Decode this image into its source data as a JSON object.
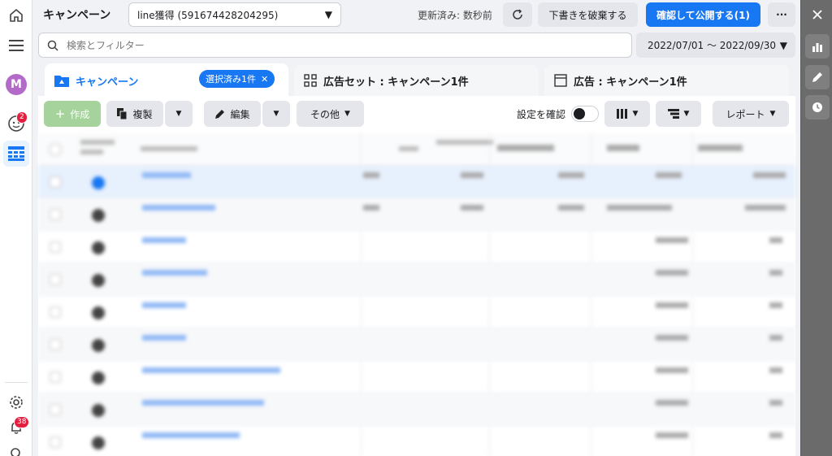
{
  "app_title": "キャンペーン",
  "account": {
    "selected": "line獲得 (591674428204295)"
  },
  "status": {
    "updated": "更新済み: 数秒前"
  },
  "buttons": {
    "discard": "下書きを破棄する",
    "publish": "確認して公開する(1)",
    "more": "···"
  },
  "search": {
    "placeholder": "検索とフィルター"
  },
  "date_range": "2022/07/01 〜 2022/09/30",
  "tabs": {
    "campaign": {
      "label": "キャンペーン",
      "chip": "選択済み1件"
    },
    "adset": {
      "label": "広告セット : キャンペーン1件"
    },
    "ad": {
      "label": "広告 : キャンペーン1件"
    }
  },
  "toolbar": {
    "create": "作成",
    "duplicate": "複製",
    "edit": "編集",
    "other": "その他",
    "review_settings": "設定を確認",
    "report": "レポート"
  },
  "notifications": {
    "profile_badge": "2",
    "bell_badge": "38"
  },
  "avatar_initial": "M",
  "colors": {
    "accent": "#1877f2",
    "create_button": "#a6d39b",
    "badge": "#e41e3f"
  }
}
